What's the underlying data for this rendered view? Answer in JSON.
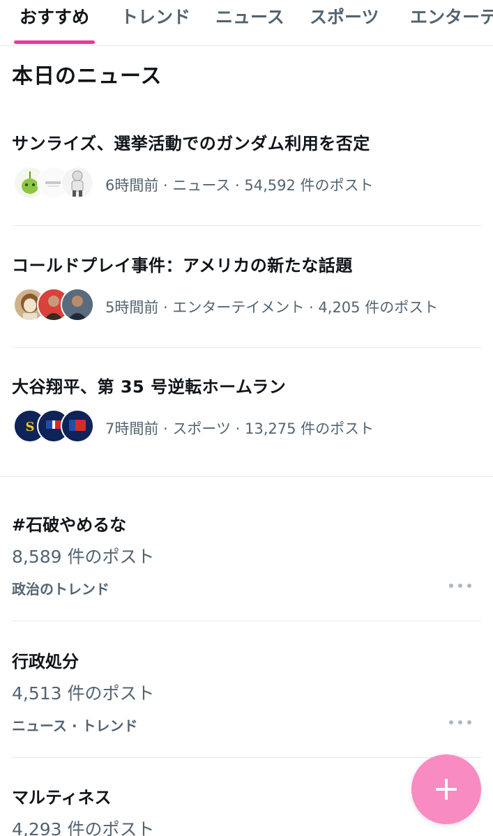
{
  "tabs": [
    {
      "label": "おすすめ",
      "active": true
    },
    {
      "label": "トレンド",
      "active": false
    },
    {
      "label": "ニュース",
      "active": false
    },
    {
      "label": "スポーツ",
      "active": false
    },
    {
      "label": "エンターテ",
      "active": false
    }
  ],
  "section": {
    "title": "本日のニュース"
  },
  "news": [
    {
      "headline": "サンライズ、選挙活動でのガンダム利用を否定",
      "meta": "6時間前 · ニュース · 54,592 件のポスト",
      "avatars": [
        "green-character-avatar",
        "brand-logo-avatar",
        "robot-avatar"
      ]
    },
    {
      "headline": "コールドプレイ事件：アメリカの新たな話題",
      "meta": "5時間前 · エンターテイメント · 4,205 件のポスト",
      "avatars": [
        "illustrated-woman-avatar",
        "person-photo-avatar",
        "person-photo-avatar"
      ]
    },
    {
      "headline": "大谷翔平、第 35 号逆転ホームラン",
      "meta": "7時間前 · スポーツ · 13,275 件のポスト",
      "avatars": [
        "baseball-team-logo-avatar",
        "mlb-japan-logo-avatar",
        "mlb-logo-avatar"
      ]
    }
  ],
  "trends": [
    {
      "name": "#石破やめるな",
      "count": "8,589 件のポスト",
      "category": "政治のトレンド"
    },
    {
      "name": "行政処分",
      "count": "4,513 件のポスト",
      "category": "ニュース · トレンド"
    },
    {
      "name": "マルティネス",
      "count": "4,293 件のポスト",
      "category": ""
    }
  ],
  "fab": {
    "icon": "plus-icon"
  },
  "colors": {
    "accent": "#f0359a",
    "fab": "#f78bc2",
    "secondary_text": "#536471"
  }
}
